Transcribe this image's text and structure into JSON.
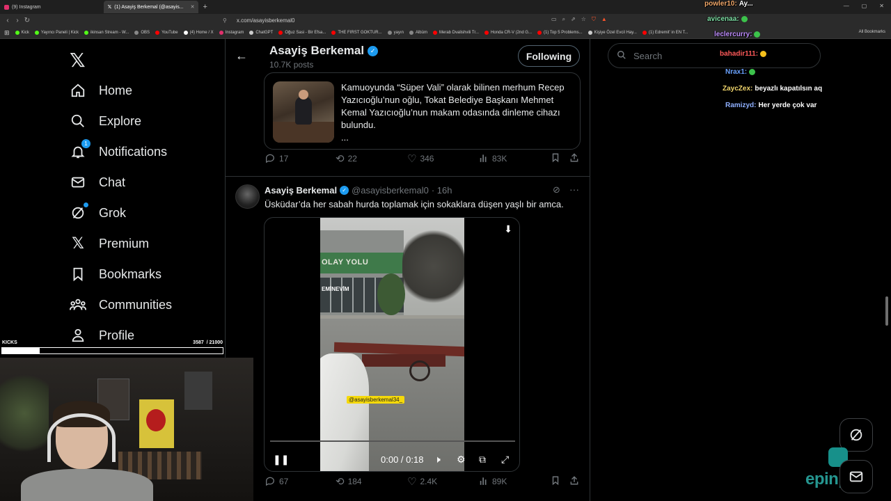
{
  "browser": {
    "tabs": [
      {
        "label": "(9) Instagram",
        "color": "#e1306c"
      },
      {
        "label": "(1) Asayiş Berkemal (@asayis...",
        "color": "#ffffff",
        "active": true
      }
    ],
    "url": "x.com/asayisberkemal0",
    "bookmarks": [
      {
        "label": "Kick",
        "color": "#53fc18"
      },
      {
        "label": "Yayıncı Paneli | Kick",
        "color": "#53fc18"
      },
      {
        "label": "ikinsan Stream - W...",
        "color": "#53fc18"
      },
      {
        "label": "OBS",
        "color": "#888888"
      },
      {
        "label": "YouTube",
        "color": "#ff0000"
      },
      {
        "label": "(4) Home / X",
        "color": "#ffffff"
      },
      {
        "label": "Instagram",
        "color": "#e1306c"
      },
      {
        "label": "ChatGPT",
        "color": "#cccccc"
      },
      {
        "label": "Oğuz Sasi - Bir Efsa...",
        "color": "#ff0000"
      },
      {
        "label": "THE FIRST GOKTUR...",
        "color": "#ff0000"
      },
      {
        "label": "yayın",
        "color": "#888888"
      },
      {
        "label": "Albüm",
        "color": "#888888"
      },
      {
        "label": "Merab Dvalishvili Tr...",
        "color": "#ff0000"
      },
      {
        "label": "Honda CR-V (2nd G...",
        "color": "#ff0000"
      },
      {
        "label": "(1) Top 5 Problems...",
        "color": "#ff0000"
      },
      {
        "label": "Kişiye Özel Evcil Hay...",
        "color": "#cccccc"
      },
      {
        "label": "(1) Edremit' in EN T...",
        "color": "#ff0000"
      }
    ],
    "all_bookmarks": "All Bookmarks"
  },
  "nav": {
    "items": [
      {
        "label": "Home",
        "icon": "home-icon"
      },
      {
        "label": "Explore",
        "icon": "search-icon"
      },
      {
        "label": "Notifications",
        "icon": "bell-icon",
        "badge": "1"
      },
      {
        "label": "Chat",
        "icon": "mail-icon"
      },
      {
        "label": "Grok",
        "icon": "grok-icon"
      },
      {
        "label": "Premium",
        "icon": "x-icon"
      },
      {
        "label": "Bookmarks",
        "icon": "bookmark-icon"
      },
      {
        "label": "Communities",
        "icon": "people-icon"
      },
      {
        "label": "Profile",
        "icon": "person-icon"
      }
    ]
  },
  "header": {
    "name": "Asayiş Berkemal",
    "posts": "10.7K posts",
    "follow_label": "Following"
  },
  "search": {
    "placeholder": "Search"
  },
  "card": {
    "text": "Kamuoyunda “Süper Vali” olarak bilinen merhum Recep Yazıcıoğlu’nun oğlu, Tokat Belediye Başkanı Mehmet Kemal Yazıcıoğlu’nun makam odasında dinleme cihazı bulundu.",
    "ellipsis": "..."
  },
  "tweet1_stats": {
    "replies": "17",
    "reposts": "22",
    "likes": "346",
    "views": "83K"
  },
  "tweet2": {
    "name": "Asayiş Berkemal",
    "handle": "@asayisberkemal0",
    "time": "· 16h",
    "text": "Üsküdar’da her sabah hurda toplamak için sokaklara düşen yaşlı bir amca.",
    "video": {
      "sign_top": "OLAY YOLU",
      "sign_bottom": "EMİNEVİM",
      "watermark": "@asayisberkemal34_",
      "time": "0:00 / 0:18",
      "progress": 0
    },
    "stats": {
      "replies": "67",
      "reposts": "184",
      "likes": "2.4K",
      "views": "89K"
    }
  },
  "overlay": {
    "kicks_label": "KICKS",
    "kicks_count": "3587",
    "kicks_goal": "/ 21000",
    "kicks_progress": 0.17,
    "chat": [
      {
        "name": "powler10:",
        "text": "Ay...",
        "color": "#f2a96b"
      },
      {
        "name": "avicenaa:",
        "text": "",
        "color": "#7fe1a6",
        "emote": "green"
      },
      {
        "name": "leclercurry:",
        "text": "",
        "color": "#c08fff",
        "emote": "green"
      },
      {
        "name": "bahadir111:",
        "text": "",
        "color": "#ff5a5a",
        "emote": "yel"
      },
      {
        "name": "Nrax1:",
        "text": "",
        "color": "#6aa2ff",
        "emote": "green"
      },
      {
        "name": "ZaycZex:",
        "text": "beyazlı kapatılsın aq",
        "color": "#f0d56c"
      },
      {
        "name": "Ramizyd:",
        "text": "Her yerde çok var",
        "color": "#8fb0ff"
      }
    ],
    "brand": "epinpay"
  }
}
